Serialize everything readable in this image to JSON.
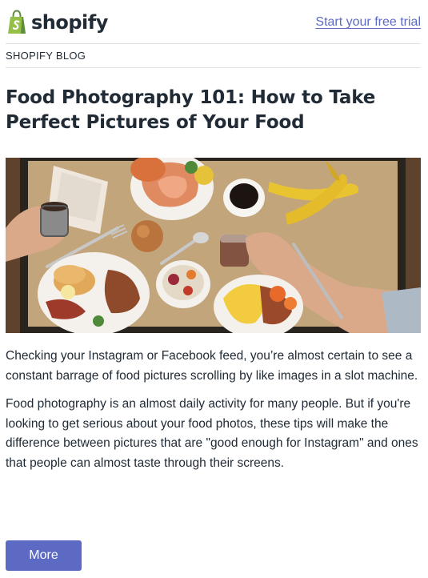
{
  "header": {
    "logo_text": "shopify",
    "cta_link": "Start your free trial"
  },
  "blog_label": "SHOPIFY BLOG",
  "article": {
    "title": "Food Photography 101: How to Take Perfect Pictures of Your Food",
    "paragraphs": [
      "Checking your Instagram or Facebook feed, you’re almost certain to see a constant barrage of food pictures scrolling by like images in a slot machine.",
      "Food photography is an almost daily activity for many people. But if you're looking to get serious about your food photos, these tips will make the difference between pictures that are \"good enough for Instagram\" and ones that people can almost taste through their screens."
    ],
    "more_button": "More"
  },
  "colors": {
    "accent": "#5c6ac4",
    "brand_green": "#95bf47",
    "text": "#212b36",
    "divider": "#dfe3e8"
  }
}
